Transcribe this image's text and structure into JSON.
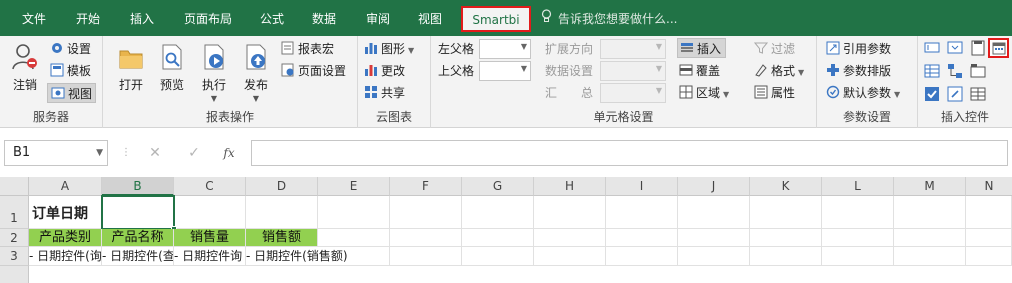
{
  "tabs": [
    {
      "label": "文件"
    },
    {
      "label": "开始"
    },
    {
      "label": "插入"
    },
    {
      "label": "页面布局"
    },
    {
      "label": "公式"
    },
    {
      "label": "数据"
    },
    {
      "label": "审阅"
    },
    {
      "label": "视图"
    },
    {
      "label": "Smartbi"
    }
  ],
  "active_tab": "Smartbi",
  "tell_me": "告诉我您想要做什么...",
  "groups": {
    "server": {
      "label": "服务器",
      "logout": "注销",
      "settings": "设置",
      "template": "模板",
      "view": "视图"
    },
    "report_ops": {
      "label": "报表操作",
      "open": "打开",
      "preview": "预览",
      "execute": "执行",
      "publish": "发布",
      "report_macro": "报表宏",
      "page_setup": "页面设置"
    },
    "cloud_chart": {
      "label": "云图表",
      "chart": "图形",
      "change": "更改",
      "share": "共享"
    },
    "cell_settings": {
      "label": "单元格设置",
      "left_parent": "左父格",
      "top_parent": "上父格",
      "expand_dir": "扩展方向",
      "data_setting": "数据设置",
      "summary": "汇　　总",
      "insert": "插入",
      "cover": "覆盖",
      "region": "区域",
      "filter": "过滤",
      "format": "格式",
      "property": "属性"
    },
    "param_settings": {
      "label": "参数设置",
      "ref_param": "引用参数",
      "param_layout": "参数排版",
      "default_param": "默认参数"
    },
    "insert_ctrl": {
      "label": "插入控件"
    }
  },
  "formula_bar": {
    "name_box": "B1",
    "cancel": "✕",
    "confirm": "✓",
    "fx": "fx",
    "formula": ""
  },
  "columns": [
    "A",
    "B",
    "C",
    "D",
    "E",
    "F",
    "G",
    "H",
    "I",
    "J",
    "K",
    "L",
    "M",
    "N"
  ],
  "selected_column": "B",
  "rows": [
    {
      "num": "1",
      "cells": {
        "A": "订单日期",
        "B": ""
      }
    },
    {
      "num": "2",
      "cells": {
        "A": "产品类别",
        "B": "产品名称",
        "C": "销售量",
        "D": "销售额"
      }
    },
    {
      "num": "3",
      "cells": {
        "A": "- 日期控件(询",
        "B": "- 日期控件(查询",
        "C": "- 日期控件询",
        "D": "- 日期控件(销售额)"
      }
    }
  ],
  "colors": {
    "accent": "#217346",
    "header_fill": "#92d050",
    "highlight_border": "#e21b1b"
  }
}
